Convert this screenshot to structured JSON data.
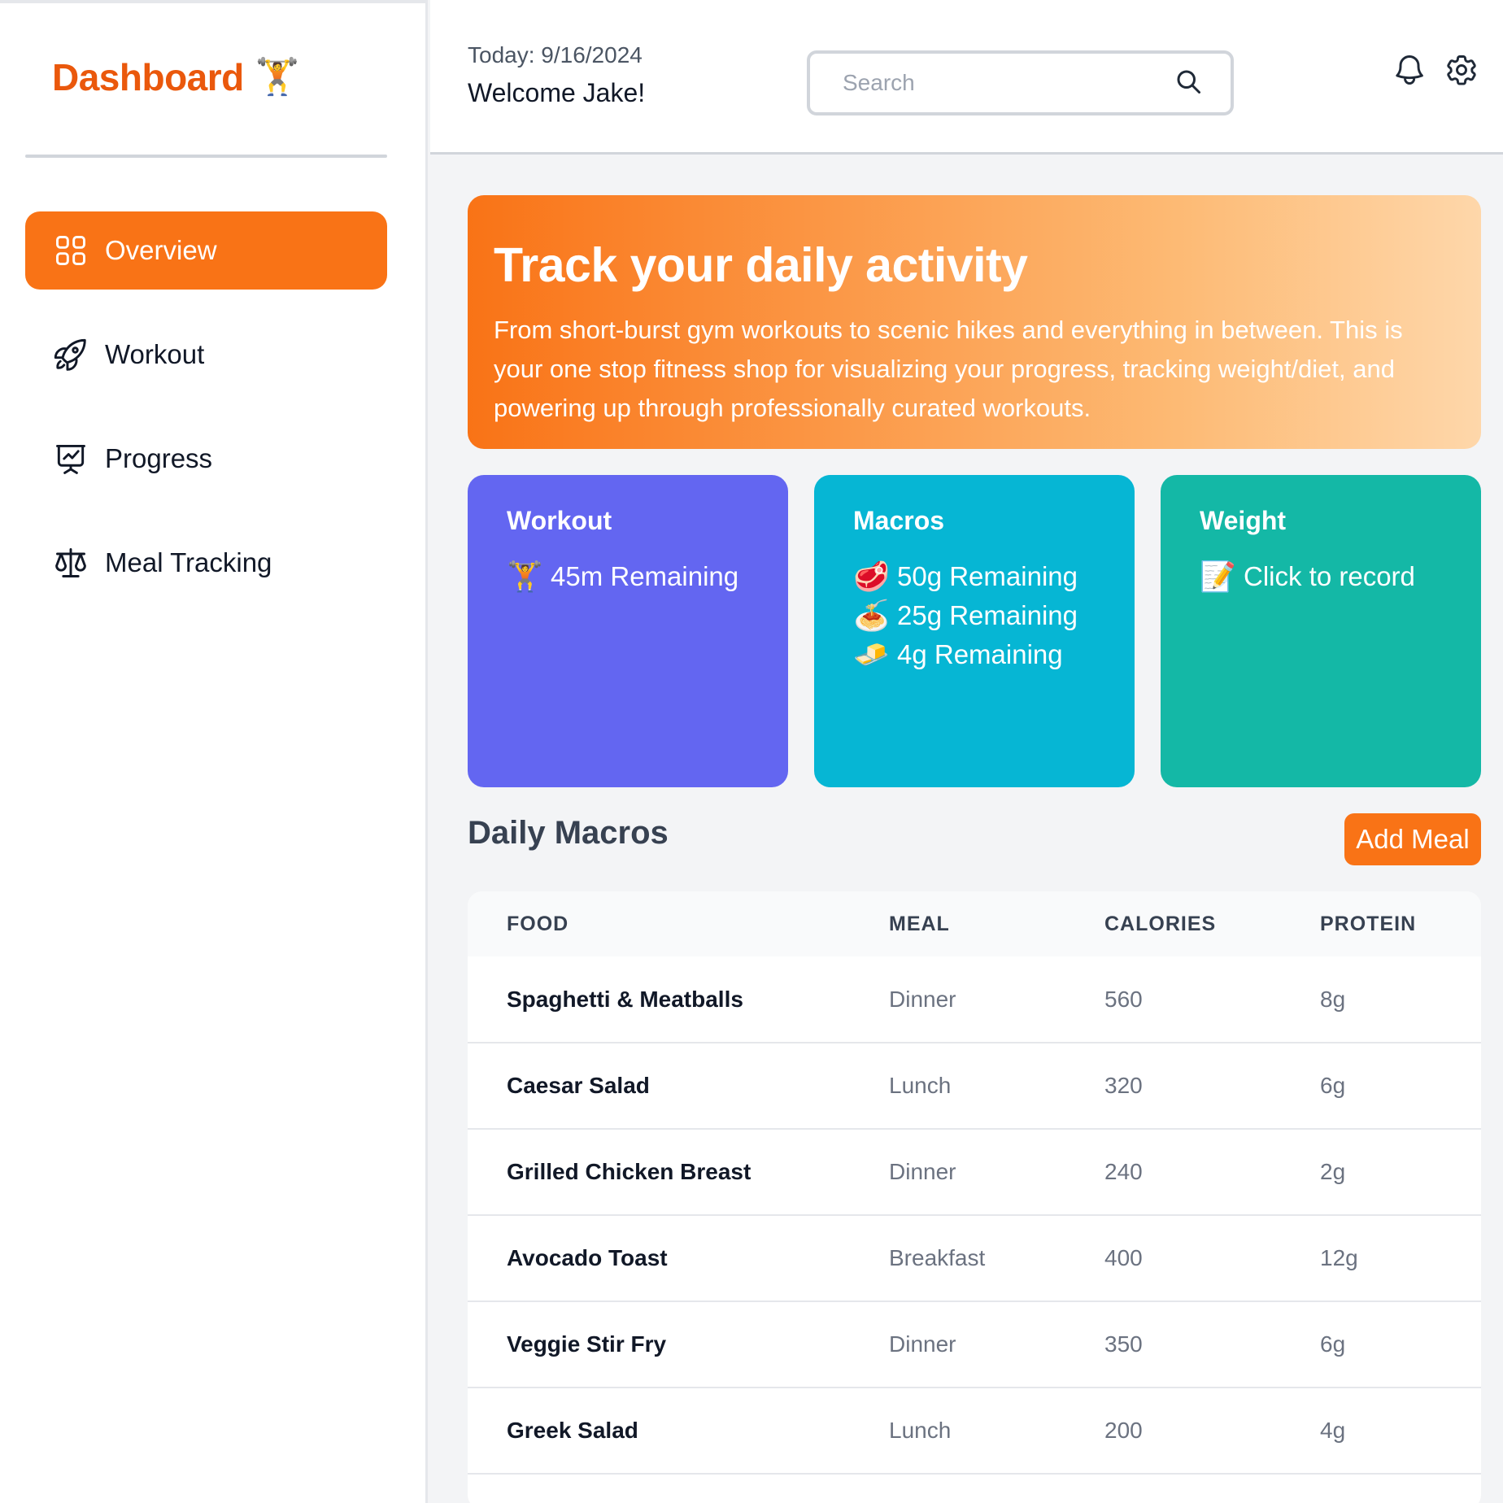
{
  "brand": {
    "title": "Dashboard",
    "emoji": "🏋️"
  },
  "sidebar": {
    "items": [
      {
        "label": "Overview",
        "icon": "grid-icon",
        "active": true
      },
      {
        "label": "Workout",
        "icon": "rocket-icon",
        "active": false
      },
      {
        "label": "Progress",
        "icon": "presentation-chart-icon",
        "active": false
      },
      {
        "label": "Meal Tracking",
        "icon": "scale-icon",
        "active": false
      }
    ]
  },
  "header": {
    "date": "Today: 9/16/2024",
    "welcome": "Welcome Jake!",
    "search_placeholder": "Search"
  },
  "hero": {
    "title": "Track your daily activity",
    "text": "From short-burst gym workouts to scenic hikes and everything in between. This is your one stop fitness shop for visualizing your progress, tracking weight/diet, and powering up through professionally curated workouts."
  },
  "cards": {
    "workout": {
      "title": "Workout",
      "lines": [
        {
          "emoji": "🏋️",
          "text": "45m Remaining"
        }
      ]
    },
    "macros": {
      "title": "Macros",
      "lines": [
        {
          "emoji": "🥩",
          "text": "50g Remaining"
        },
        {
          "emoji": "🍝",
          "text": "25g Remaining"
        },
        {
          "emoji": "🧈",
          "text": "4g Remaining"
        }
      ]
    },
    "weight": {
      "title": "Weight",
      "lines": [
        {
          "emoji": "📝",
          "text": "Click to record"
        }
      ]
    }
  },
  "daily_macros": {
    "title": "Daily Macros",
    "add_button": "Add Meal",
    "columns": [
      "FOOD",
      "MEAL",
      "CALORIES",
      "PROTEIN"
    ],
    "rows": [
      [
        "Spaghetti & Meatballs",
        "Dinner",
        "560",
        "8g"
      ],
      [
        "Caesar Salad",
        "Lunch",
        "320",
        "6g"
      ],
      [
        "Grilled Chicken Breast",
        "Dinner",
        "240",
        "2g"
      ],
      [
        "Avocado Toast",
        "Breakfast",
        "400",
        "12g"
      ],
      [
        "Veggie Stir Fry",
        "Dinner",
        "350",
        "6g"
      ],
      [
        "Greek Salad",
        "Lunch",
        "200",
        "4g"
      ]
    ]
  },
  "colors": {
    "accent": "#f97316",
    "brand": "#ea580c",
    "workout_card": "#6366f1",
    "macros_card": "#06b6d4",
    "weight_card": "#14b8a6"
  }
}
